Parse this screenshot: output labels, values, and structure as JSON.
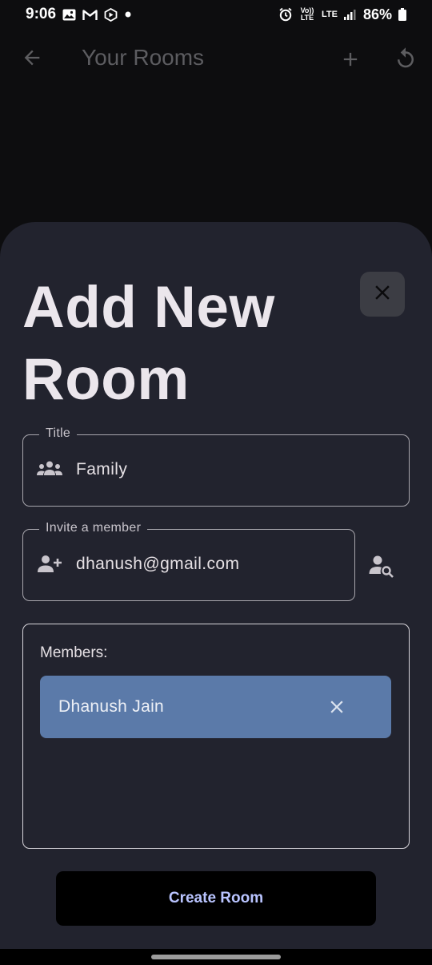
{
  "status_bar": {
    "time": "9:06",
    "volte": "Vo)) LTE",
    "lte": "LTE",
    "battery": "86%"
  },
  "app_bar": {
    "title": "Your Rooms",
    "icons": [
      "arrow-back-icon",
      "add-icon",
      "refresh-icon"
    ]
  },
  "sheet": {
    "title": "Add New Room",
    "title_field": {
      "label": "Title",
      "value": "Family",
      "icon": "groups-icon"
    },
    "invite_field": {
      "label": "Invite a member",
      "value": "dhanush@gmail.com",
      "icon": "person-add-icon"
    },
    "members": {
      "label": "Members:",
      "items": [
        {
          "name": "Dhanush Jain"
        }
      ]
    },
    "create_button": "Create Room"
  },
  "colors": {
    "sheet_bg": "#22232e",
    "chip_bg": "#5b7aa9",
    "button_text": "#b9c4ff",
    "close_bg": "#3c3d44"
  }
}
